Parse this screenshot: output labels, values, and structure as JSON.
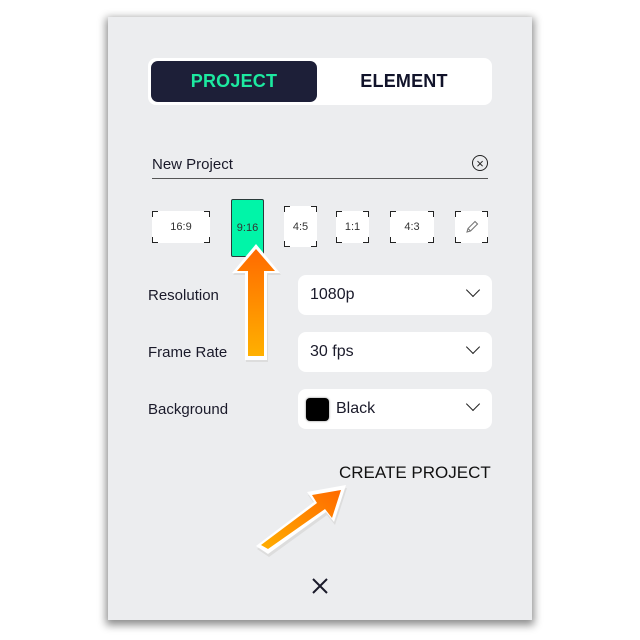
{
  "tabs": [
    {
      "label": "PROJECT",
      "active": true
    },
    {
      "label": "ELEMENT",
      "active": false
    }
  ],
  "project_name": {
    "value": "New Project",
    "clear_icon": "circle-x-icon"
  },
  "aspect_ratios": [
    {
      "label": "16:9",
      "selected": false
    },
    {
      "label": "9:16",
      "selected": true
    },
    {
      "label": "4:5",
      "selected": false
    },
    {
      "label": "1:1",
      "selected": false
    },
    {
      "label": "4:3",
      "selected": false
    },
    {
      "label": "",
      "icon": "pencil-icon",
      "selected": false
    }
  ],
  "settings": {
    "resolution": {
      "label": "Resolution",
      "value": "1080p"
    },
    "frame_rate": {
      "label": "Frame Rate",
      "value": "30 fps"
    },
    "background": {
      "label": "Background",
      "value": "Black",
      "swatch_color": "#000000"
    }
  },
  "create_button": "CREATE PROJECT",
  "close_icon": "close-x-icon",
  "colors": {
    "accent_green": "#00f5a8",
    "tab_active_bg": "#1d1f38",
    "tab_active_text": "#1de9a0",
    "annotation_arrow": "#ff7a00"
  }
}
